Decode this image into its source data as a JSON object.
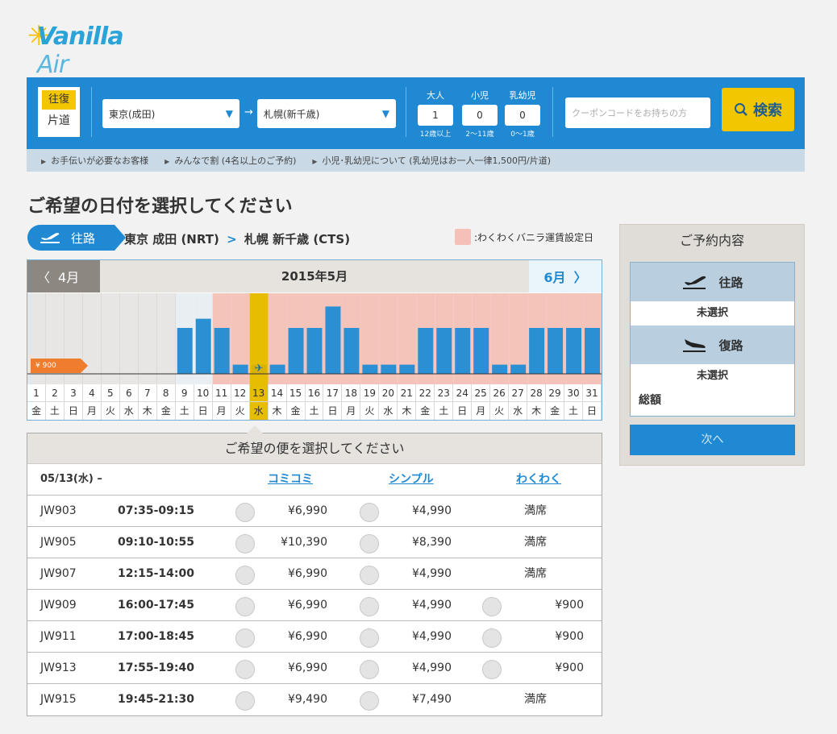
{
  "logo": {
    "brand": "Vanilla",
    "suffix": "Air"
  },
  "search": {
    "trip_roundtrip": "往復",
    "trip_oneway": "片道",
    "from": "東京(成田)",
    "arrow": "→",
    "to": "札幌(新千歳)",
    "pax": [
      {
        "label": "大人",
        "value": "1",
        "note": "12歳以上"
      },
      {
        "label": "小児",
        "value": "0",
        "note": "2〜11歳"
      },
      {
        "label": "乳幼児",
        "value": "0",
        "note": "0〜1歳"
      }
    ],
    "coupon_placeholder": "クーポンコードをお持ちの方",
    "search_button": "検索",
    "links": [
      "お手伝いが必要なお客様",
      "みんなで割 (4名以上のご予約)",
      "小児･乳幼児について (乳幼児はお一人一律1,500円/片道)"
    ]
  },
  "heading": "ご希望の日付を選択してください",
  "route": {
    "direction": "往路",
    "origin": "東京 成田 (NRT)",
    "chev": ">",
    "destination": "札幌 新千歳 (CTS)",
    "legend": ":わくわくバニラ運賃設定日"
  },
  "calendar": {
    "prev_label": "4月",
    "month_label": "2015年5月",
    "next_label": "6月",
    "min_price_tag": "¥ 900",
    "selected_day": 13,
    "days": [
      {
        "d": "1",
        "w": "金",
        "fare": null,
        "wakuwaku": false
      },
      {
        "d": "2",
        "w": "土",
        "fare": null,
        "wakuwaku": false
      },
      {
        "d": "3",
        "w": "日",
        "fare": null,
        "wakuwaku": false
      },
      {
        "d": "4",
        "w": "月",
        "fare": null,
        "wakuwaku": false
      },
      {
        "d": "5",
        "w": "火",
        "fare": null,
        "wakuwaku": false
      },
      {
        "d": "6",
        "w": "水",
        "fare": null,
        "wakuwaku": false
      },
      {
        "d": "7",
        "w": "木",
        "fare": null,
        "wakuwaku": false
      },
      {
        "d": "8",
        "w": "金",
        "fare": null,
        "wakuwaku": false
      },
      {
        "d": "9",
        "w": "土",
        "fare": 0.6,
        "wakuwaku": false
      },
      {
        "d": "10",
        "w": "日",
        "fare": 0.72,
        "wakuwaku": false
      },
      {
        "d": "11",
        "w": "月",
        "fare": 0.6,
        "wakuwaku": true
      },
      {
        "d": "12",
        "w": "火",
        "fare": 0.12,
        "wakuwaku": true
      },
      {
        "d": "13",
        "w": "水",
        "fare": 0.12,
        "wakuwaku": true
      },
      {
        "d": "14",
        "w": "木",
        "fare": 0.12,
        "wakuwaku": true
      },
      {
        "d": "15",
        "w": "金",
        "fare": 0.6,
        "wakuwaku": true
      },
      {
        "d": "16",
        "w": "土",
        "fare": 0.6,
        "wakuwaku": true
      },
      {
        "d": "17",
        "w": "日",
        "fare": 0.88,
        "wakuwaku": true
      },
      {
        "d": "18",
        "w": "月",
        "fare": 0.6,
        "wakuwaku": true
      },
      {
        "d": "19",
        "w": "火",
        "fare": 0.12,
        "wakuwaku": true
      },
      {
        "d": "20",
        "w": "水",
        "fare": 0.12,
        "wakuwaku": true
      },
      {
        "d": "21",
        "w": "木",
        "fare": 0.12,
        "wakuwaku": true
      },
      {
        "d": "22",
        "w": "金",
        "fare": 0.6,
        "wakuwaku": true
      },
      {
        "d": "23",
        "w": "土",
        "fare": 0.6,
        "wakuwaku": true
      },
      {
        "d": "24",
        "w": "日",
        "fare": 0.6,
        "wakuwaku": true
      },
      {
        "d": "25",
        "w": "月",
        "fare": 0.6,
        "wakuwaku": true
      },
      {
        "d": "26",
        "w": "火",
        "fare": 0.12,
        "wakuwaku": true
      },
      {
        "d": "27",
        "w": "水",
        "fare": 0.12,
        "wakuwaku": true
      },
      {
        "d": "28",
        "w": "木",
        "fare": 0.6,
        "wakuwaku": true
      },
      {
        "d": "29",
        "w": "金",
        "fare": 0.6,
        "wakuwaku": true
      },
      {
        "d": "30",
        "w": "土",
        "fare": 0.6,
        "wakuwaku": true
      },
      {
        "d": "31",
        "w": "日",
        "fare": 0.6,
        "wakuwaku": true
      }
    ]
  },
  "reservation": {
    "title": "ご予約内容",
    "outbound": "往路",
    "outbound_status": "未選択",
    "return": "復路",
    "return_status": "未選択",
    "total_label": "総額",
    "next_button": "次へ"
  },
  "flights": {
    "title": "ご希望の便を選択してください",
    "date": "05/13(水) –",
    "columns": [
      "コミコミ",
      "シンプル",
      "わくわく"
    ],
    "rows": [
      {
        "no": "JW903",
        "time": "07:35-09:15",
        "komikomi": "¥6,990",
        "simple": "¥4,990",
        "wakuwaku": "満席"
      },
      {
        "no": "JW905",
        "time": "09:10-10:55",
        "komikomi": "¥10,390",
        "simple": "¥8,390",
        "wakuwaku": "満席"
      },
      {
        "no": "JW907",
        "time": "12:15-14:00",
        "komikomi": "¥6,990",
        "simple": "¥4,990",
        "wakuwaku": "満席"
      },
      {
        "no": "JW909",
        "time": "16:00-17:45",
        "komikomi": "¥6,990",
        "simple": "¥4,990",
        "wakuwaku": "¥900"
      },
      {
        "no": "JW911",
        "time": "17:00-18:45",
        "komikomi": "¥6,990",
        "simple": "¥4,990",
        "wakuwaku": "¥900"
      },
      {
        "no": "JW913",
        "time": "17:55-19:40",
        "komikomi": "¥6,990",
        "simple": "¥4,990",
        "wakuwaku": "¥900"
      },
      {
        "no": "JW915",
        "time": "19:45-21:30",
        "komikomi": "¥9,490",
        "simple": "¥7,490",
        "wakuwaku": "満席"
      }
    ]
  },
  "colors": {
    "brand_blue": "#1f8ad3",
    "accent_yellow": "#f2c600",
    "wakuwaku_pink": "#f4c0b8",
    "bar_blue": "#2b8fd4"
  }
}
